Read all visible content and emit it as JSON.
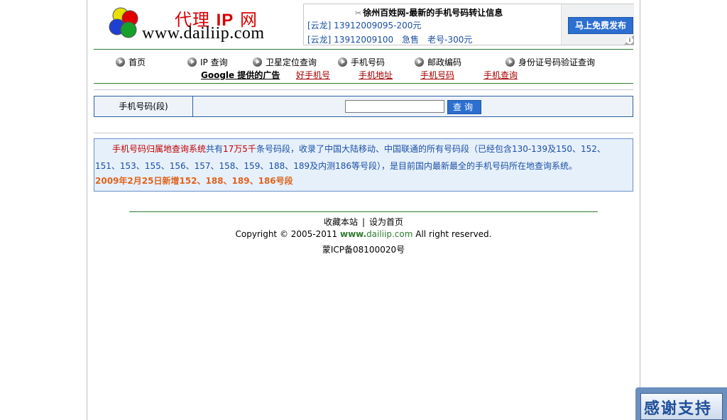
{
  "logo": {
    "cn_prefix": "代理",
    "cn_ip": "IP",
    "cn_suffix": "网",
    "url": "www.dailiip.com"
  },
  "ad": {
    "title": "徐州百姓网-最新的手机号码转让信息",
    "line1": "[云龙] 13912009095-200元",
    "line2": "[云龙] 13912009100　急售　老号-300元",
    "button": "马上免费发布",
    "info_icon": "i"
  },
  "nav": {
    "items": [
      {
        "label": "首页"
      },
      {
        "label": "IP 查询"
      },
      {
        "label": "卫星定位查询"
      },
      {
        "label": "手机号码"
      },
      {
        "label": "邮政编码"
      },
      {
        "label": "身份证号码验证查询"
      }
    ],
    "google_label": "Google 提供的广告",
    "ad_links": [
      {
        "label": "好手机号"
      },
      {
        "label": "手机地址"
      },
      {
        "label": "手机号码"
      },
      {
        "label": "手机查询"
      }
    ]
  },
  "query": {
    "label": "手机号码(段)",
    "input_value": "",
    "button": "查询"
  },
  "info": {
    "lead_red": "手机号码归属地查询系统",
    "text1": "共有",
    "count": "17万5千",
    "text2": "条号码段，收录了中国大陆移动、中国联通的所有号码段（已经包含130-139及150、152、151、153、155、156、157、158、159、188、189及内测186等号段），是目前国内最新最全的手机号码所在地查询系统。",
    "update": "2009年2月25日新增152、188、189、186号段"
  },
  "footer": {
    "bookmark": "收藏本站",
    "separator": "|",
    "homepage": "设为首页",
    "copyright_prefix": "Copyright © 2005-2011 ",
    "copyright_www": "www.",
    "copyright_domain": "dailiip.com",
    "copyright_suffix": " All right reserved.",
    "icp": "蒙ICP备08100020号"
  },
  "support_badge": "感谢支持",
  "colors": {
    "accent_blue": "#2c6fd0",
    "text_blue": "#1b4fa5",
    "link_red": "#a50000",
    "brand_red": "#d90000",
    "update_orange": "#e0631d",
    "divider_green": "#2f7a2f"
  }
}
